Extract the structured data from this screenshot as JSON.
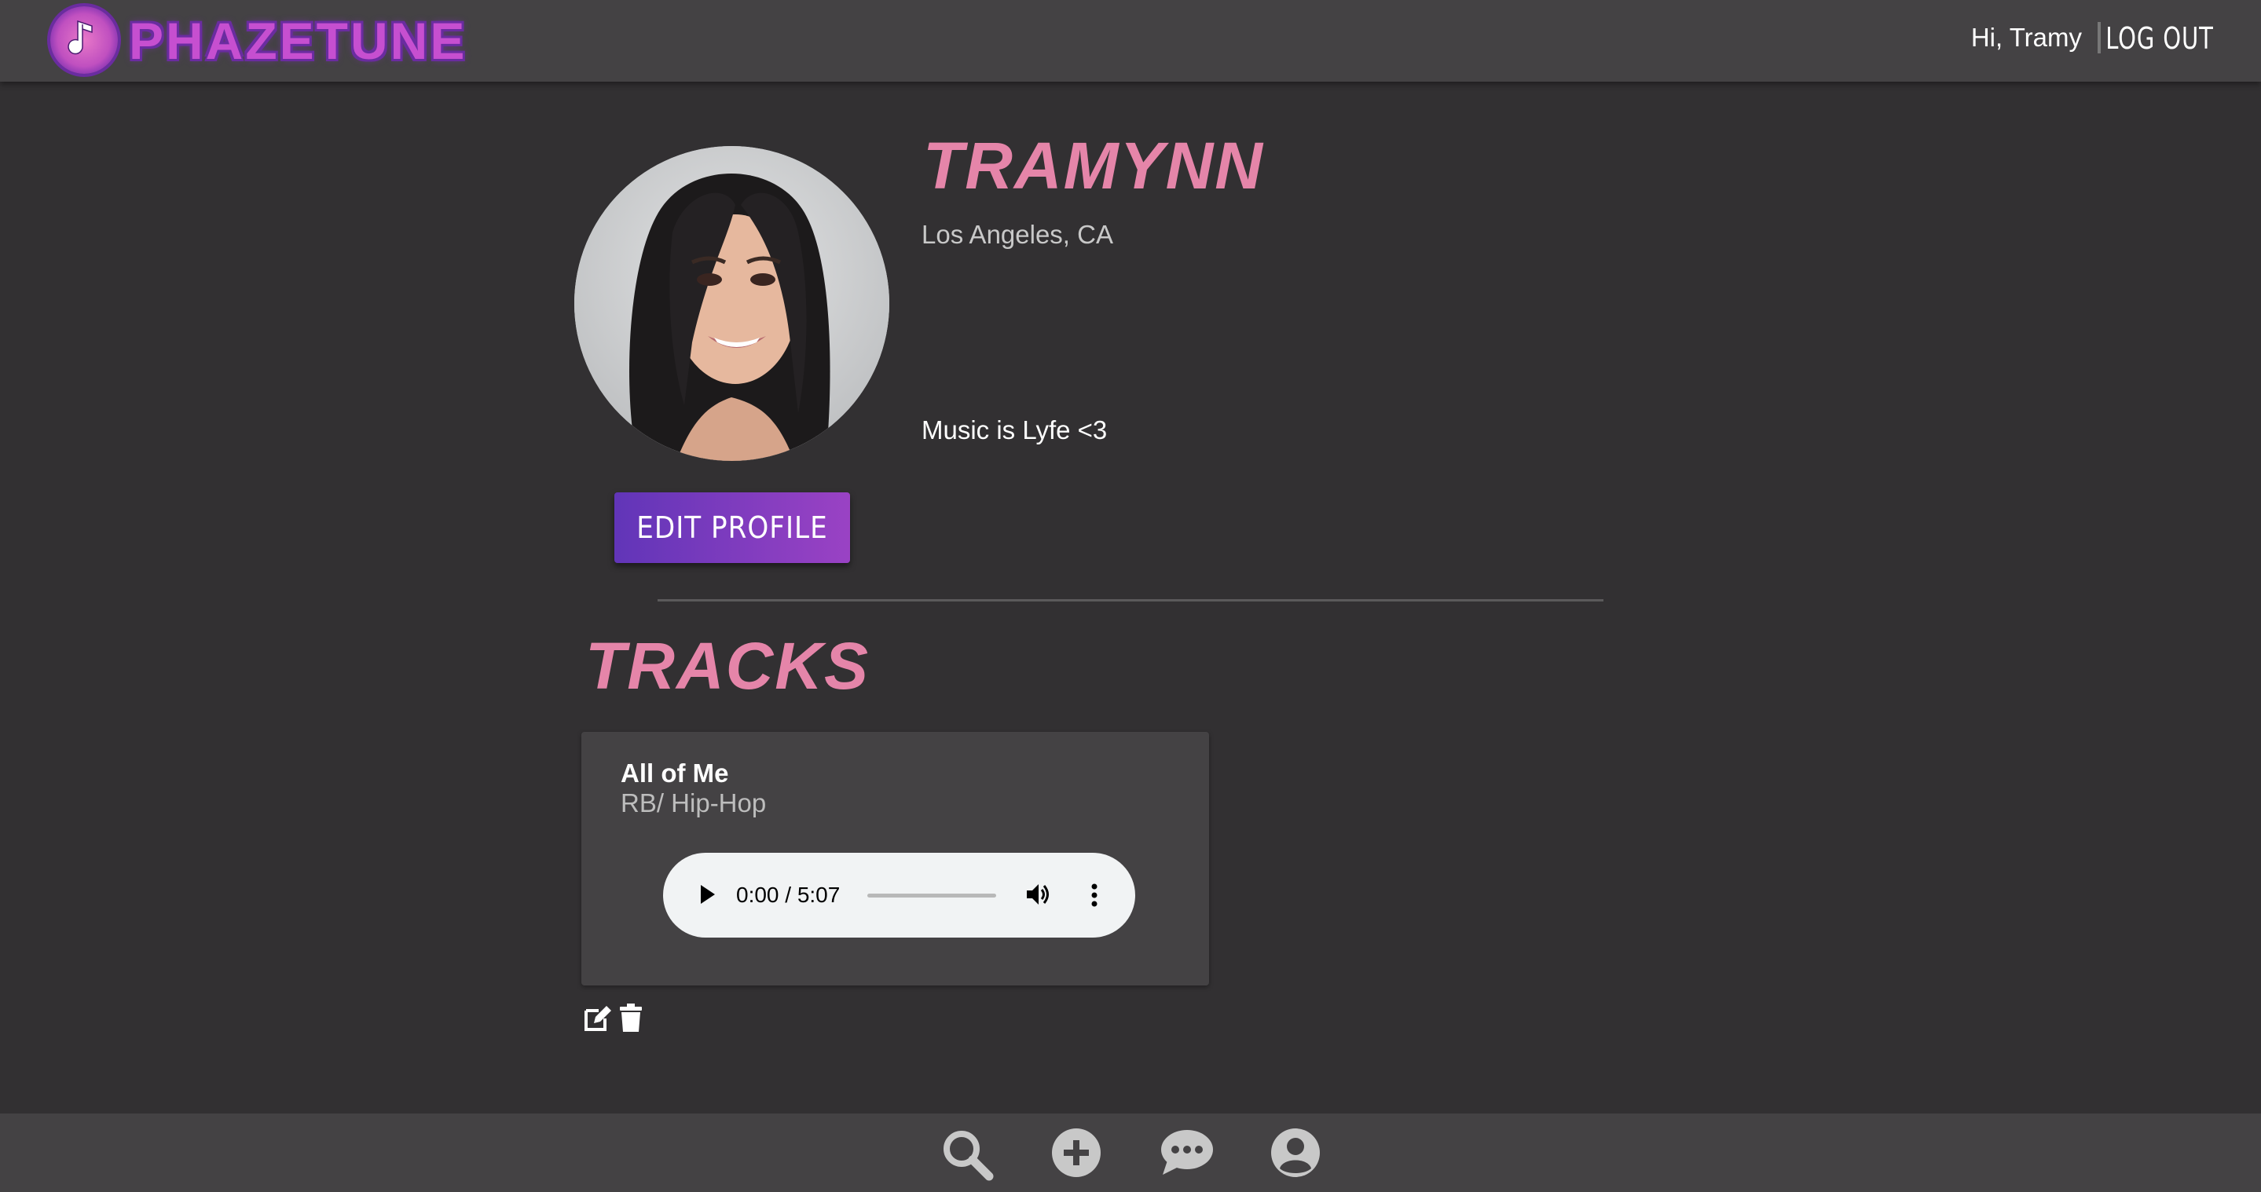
{
  "header": {
    "brand": "PHAZETUNE",
    "greeting": "Hi, Tramy",
    "logout_label": "LOG OUT"
  },
  "profile": {
    "username": "TRAMYNN",
    "location": "Los Angeles, CA",
    "bio": "Music is Lyfe <3",
    "edit_label": "EDIT PROFILE"
  },
  "tracks": {
    "heading": "TRACKS",
    "items": [
      {
        "title": "All of Me",
        "genre": "RB/ Hip-Hop",
        "time_display": "0:00 / 5:07",
        "progress": 0
      }
    ]
  },
  "bottom_nav": {
    "icons": [
      "search-icon",
      "plus-icon",
      "chat-icon",
      "user-icon"
    ]
  },
  "colors": {
    "accent_pink": "#e585a9",
    "brand_purple": "#c64fd0",
    "button_gradient_start": "#6135b8",
    "button_gradient_end": "#9a42c4",
    "background": "#323032",
    "bar": "#444244"
  }
}
